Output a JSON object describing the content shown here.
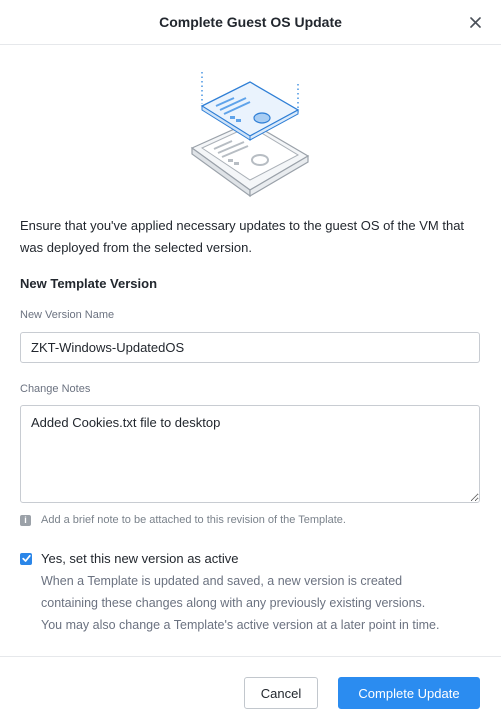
{
  "dialog": {
    "title": "Complete Guest OS Update",
    "close_icon": "close-icon",
    "intro": "Ensure that you've applied necessary updates to the guest OS of the VM that was deployed from the selected version.",
    "section_title": "New Template Version",
    "version_name": {
      "label": "New Version Name",
      "value": "ZKT-Windows-UpdatedOS"
    },
    "change_notes": {
      "label": "Change Notes",
      "value": "Added Cookies.txt file to desktop",
      "hint": "Add a brief note to be attached to this revision of the Template."
    },
    "set_active": {
      "checked": true,
      "label": "Yes, set this new version as active",
      "description_lines": [
        "When a Template is updated and saved, a new version is created",
        "containing these changes along with any previously existing versions.",
        "You may also change a Template's active version at a later point in time."
      ]
    },
    "buttons": {
      "cancel": "Cancel",
      "primary": "Complete Update"
    },
    "colors": {
      "accent": "#2b8cf0",
      "checkbox": "#2b86e8",
      "text": "#22272e",
      "muted": "#6b7280"
    }
  }
}
